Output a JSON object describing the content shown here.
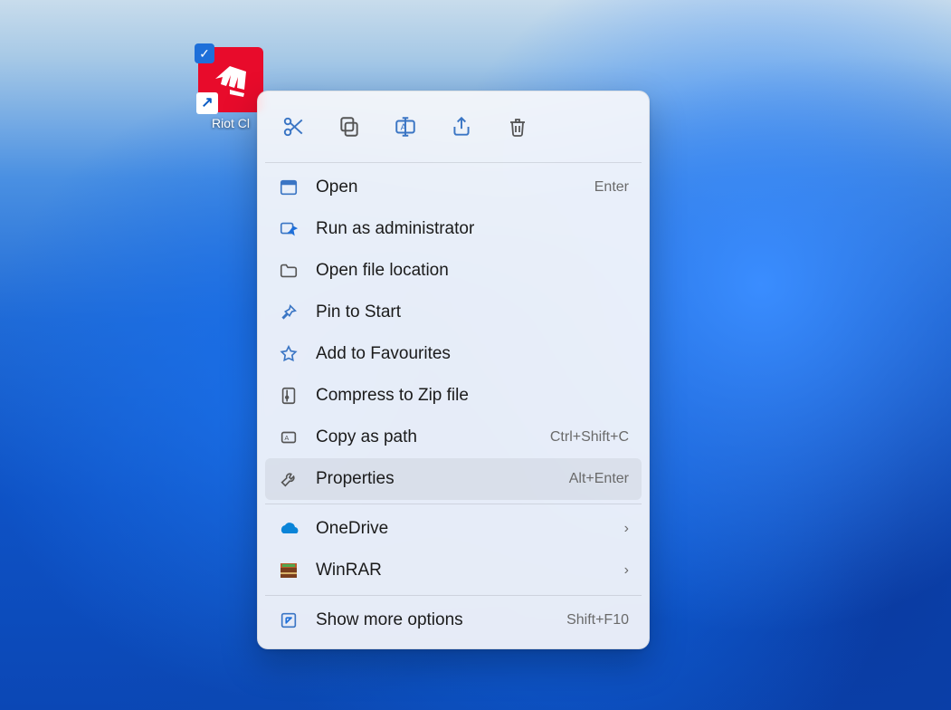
{
  "desktop_icon": {
    "label": "Riot Cl",
    "selected": true,
    "is_shortcut": true
  },
  "context_menu": {
    "action_bar": [
      {
        "name": "cut"
      },
      {
        "name": "copy"
      },
      {
        "name": "rename"
      },
      {
        "name": "share"
      },
      {
        "name": "delete"
      }
    ],
    "groups": [
      {
        "items": [
          {
            "icon": "open",
            "label": "Open",
            "shortcut": "Enter"
          },
          {
            "icon": "shield",
            "label": "Run as administrator",
            "shortcut": ""
          },
          {
            "icon": "folder",
            "label": "Open file location",
            "shortcut": ""
          },
          {
            "icon": "pin",
            "label": "Pin to Start",
            "shortcut": ""
          },
          {
            "icon": "star",
            "label": "Add to Favourites",
            "shortcut": ""
          },
          {
            "icon": "zip",
            "label": "Compress to Zip file",
            "shortcut": ""
          },
          {
            "icon": "path",
            "label": "Copy as path",
            "shortcut": "Ctrl+Shift+C"
          },
          {
            "icon": "wrench",
            "label": "Properties",
            "shortcut": "Alt+Enter",
            "hovered": true
          }
        ]
      },
      {
        "items": [
          {
            "icon": "onedrive",
            "label": "OneDrive",
            "submenu": true
          },
          {
            "icon": "winrar",
            "label": "WinRAR",
            "submenu": true
          }
        ]
      },
      {
        "items": [
          {
            "icon": "more",
            "label": "Show more options",
            "shortcut": "Shift+F10"
          }
        ]
      }
    ]
  }
}
